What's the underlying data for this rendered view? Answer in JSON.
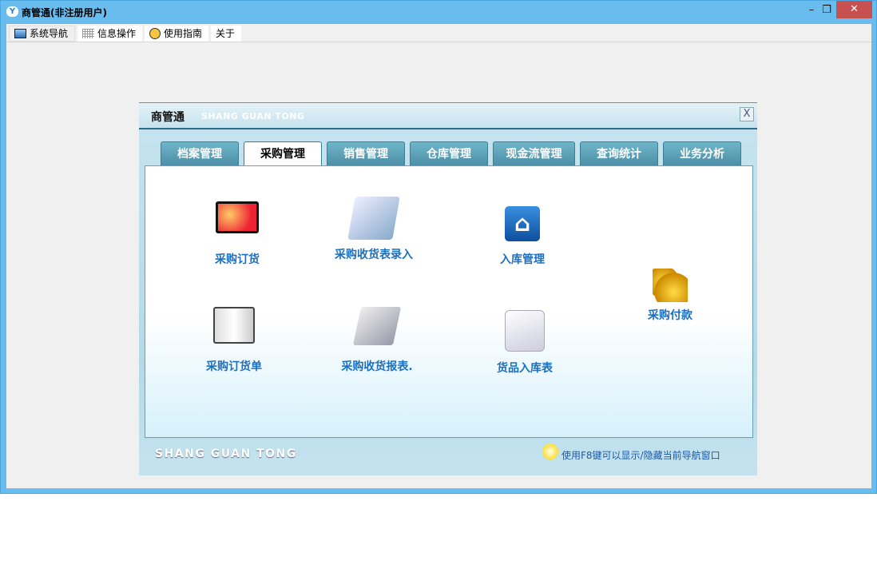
{
  "window": {
    "title": "商管通(非注册用户)",
    "minimize": "–",
    "restore": "❐",
    "close": "✕"
  },
  "menubar": [
    {
      "label": "系统导航",
      "icon": "monitor-icon"
    },
    {
      "label": "信息操作",
      "icon": "grid-icon"
    },
    {
      "label": "使用指南",
      "icon": "help-icon"
    },
    {
      "label": "关于"
    }
  ],
  "panel": {
    "title": "商管通",
    "subtitle": "SHANG GUAN TONG",
    "close": "X",
    "tabs": [
      "档案管理",
      "采购管理",
      "销售管理",
      "仓库管理",
      "现金流管理",
      "查询统计",
      "业务分析"
    ],
    "active_tab": 1,
    "items": [
      {
        "label": "采购订货",
        "icon": "monitor-icon"
      },
      {
        "label": "采购收货表录入",
        "icon": "document-edit-icon"
      },
      {
        "label": "入库管理",
        "icon": "home-icon"
      },
      {
        "label": "采购付款",
        "icon": "coins-icon"
      },
      {
        "label": "采购订货单",
        "icon": "notebook-icon"
      },
      {
        "label": "采购收货报表.",
        "icon": "report-icon"
      },
      {
        "label": "货品入库表",
        "icon": "scroll-pen-icon"
      }
    ],
    "footer_logo": "SHANG GUAN TONG",
    "hint": "使用F8键可以显示/隐藏当前导航窗口"
  }
}
